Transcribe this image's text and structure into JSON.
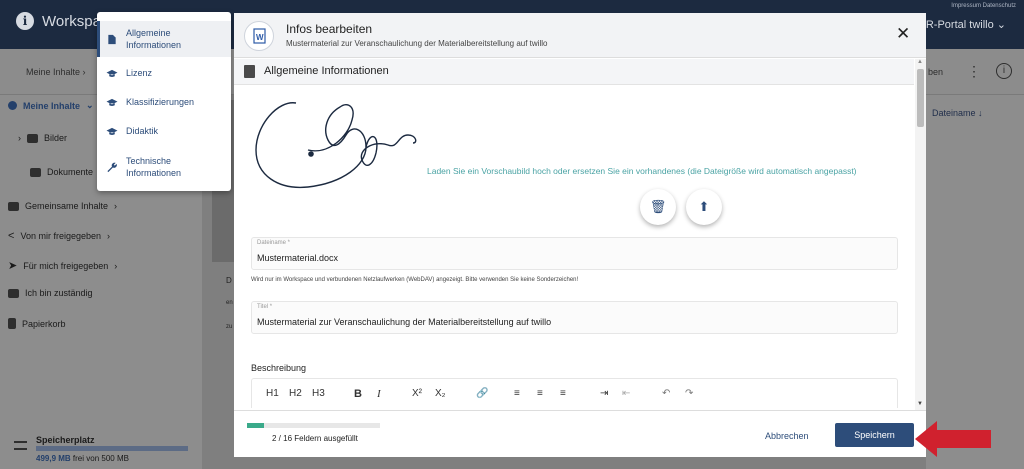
{
  "topbar": {
    "workspace": "Workspace",
    "impressum": "Impressum  Datenschutz",
    "portal": "ER-Portal twillo"
  },
  "subbar": {
    "breadcrumb": "Meine Inhalte",
    "right_trunc": "ben"
  },
  "sidebar": {
    "items": [
      {
        "label": "Meine Inhalte"
      },
      {
        "label": "Bilder"
      },
      {
        "label": "Dokumente"
      },
      {
        "label": "Gemeinsame Inhalte"
      },
      {
        "label": "Von mir freigegeben"
      },
      {
        "label": "Für mich freigegeben"
      },
      {
        "label": "Ich bin zuständig"
      },
      {
        "label": "Papierkorb"
      }
    ],
    "storage": {
      "title": "Speicherplatz",
      "used": "499,9 MB",
      "suffix": "frei von 500 MB",
      "used_fraction": 0.9998
    }
  },
  "background_list": {
    "col_header": "Dateiname",
    "trunc": [
      "D",
      "en",
      "zu"
    ]
  },
  "menu": {
    "items": [
      {
        "label": "Allgemeine Informationen",
        "active": true
      },
      {
        "label": "Lizenz"
      },
      {
        "label": "Klassifizierungen"
      },
      {
        "label": "Didaktik"
      },
      {
        "label": "Technische Informationen"
      }
    ]
  },
  "dialog": {
    "title": "Infos bearbeiten",
    "subtitle": "Mustermaterial zur Veranschaulichung der Materialbereitstellung auf twillo",
    "section": "Allgemeine Informationen",
    "preview_hint": "Laden Sie ein Vorschaubild hoch oder ersetzen Sie ein vorhandenes (die Dateigröße wird automatisch angepasst)",
    "filename_label": "Dateiname *",
    "filename_value": "Mustermaterial.docx",
    "filename_help": "Wird nur im Workspace und verbundenen Netzlaufwerken (WebDAV) angezeigt. Bitte verwenden Sie keine Sonderzeichen!",
    "title_label": "Titel *",
    "title_value": "Mustermaterial zur Veranschaulichung der Materialbereitstellung auf twillo",
    "description_label": "Beschreibung",
    "toolbar": {
      "h1": "H1",
      "h2": "H2",
      "h3": "H3",
      "bold": "B",
      "italic": "I",
      "sup": "X²",
      "sub": "X₂"
    },
    "footer": {
      "progress_text": "2 / 16 Feldern ausgefüllt",
      "filled": 2,
      "total": 16,
      "cancel": "Abbrechen",
      "save": "Speichern"
    }
  },
  "colors": {
    "accent": "#2d4d7a",
    "teal": "#4aa3a4",
    "progress": "#3aaa8a",
    "arrow": "#d0212e"
  }
}
